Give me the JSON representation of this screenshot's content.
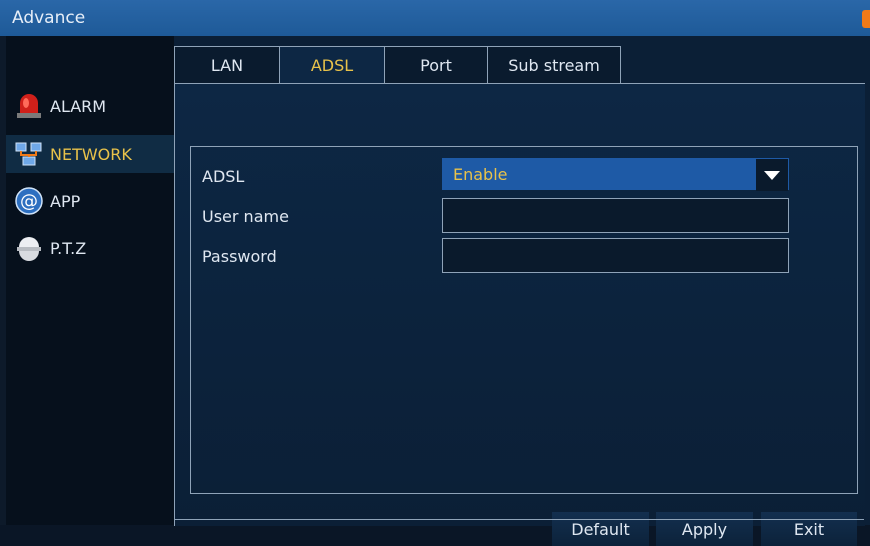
{
  "window": {
    "title": "Advance"
  },
  "sidebar": {
    "items": [
      {
        "label": "ALARM",
        "icon": "alarm-siren-icon",
        "active": false
      },
      {
        "label": "NETWORK",
        "icon": "network-icon",
        "active": true
      },
      {
        "label": "APP",
        "icon": "at-sign-icon",
        "active": false
      },
      {
        "label": "P.T.Z",
        "icon": "ptz-dome-camera-icon",
        "active": false
      }
    ]
  },
  "tabs": [
    {
      "label": "LAN",
      "active": false
    },
    {
      "label": "ADSL",
      "active": true
    },
    {
      "label": "Port",
      "active": false
    },
    {
      "label": "Sub stream",
      "active": false
    }
  ],
  "form": {
    "adsl_label": "ADSL",
    "adsl_value": "Enable",
    "username_label": "User name",
    "username_value": "",
    "password_label": "Password",
    "password_value": ""
  },
  "buttons": {
    "default": "Default",
    "apply": "Apply",
    "exit": "Exit"
  },
  "colors": {
    "titlebar": "#1e5a98",
    "accent_text": "#e8c24a",
    "select_bg": "#1e5aa6",
    "close": "#f07a18"
  }
}
